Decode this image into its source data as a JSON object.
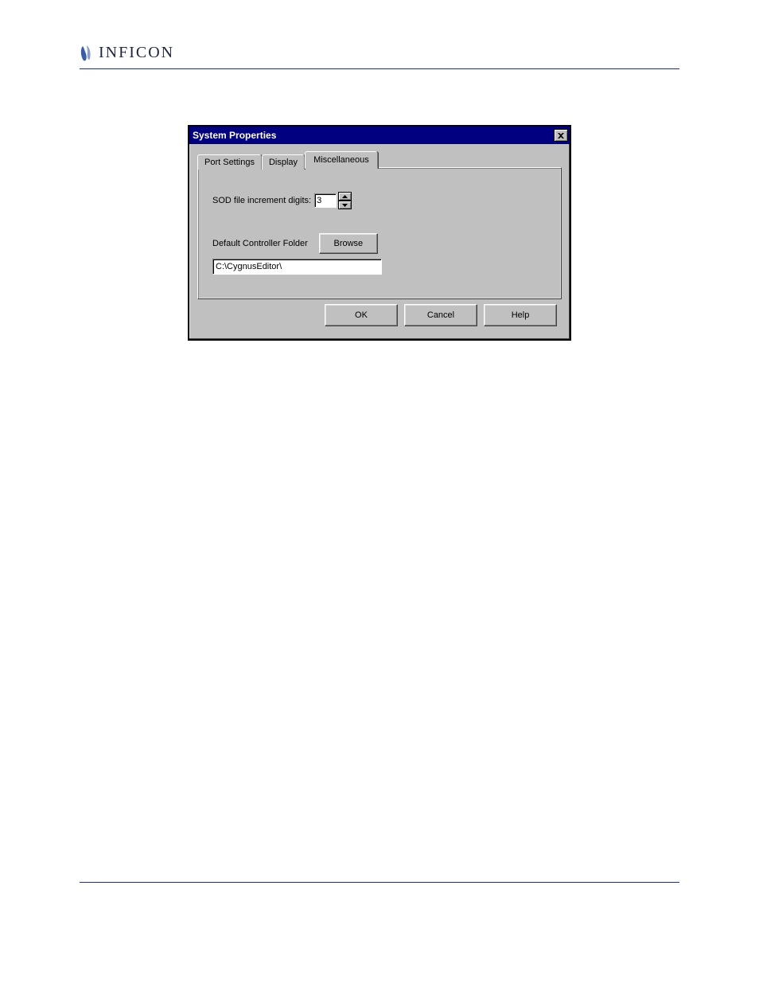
{
  "brand_name": "INFICON",
  "dialog": {
    "title": "System Properties",
    "tabs": {
      "port_settings": "Port Settings",
      "display": "Display",
      "miscellaneous": "Miscellaneous"
    },
    "sod_label": "SOD file increment digits:",
    "sod_value": "3",
    "default_folder_label": "Default Controller Folder",
    "browse_label": "Browse",
    "path_value": "C:\\CygnusEditor\\",
    "buttons": {
      "ok": "OK",
      "cancel": "Cancel",
      "help": "Help"
    }
  }
}
